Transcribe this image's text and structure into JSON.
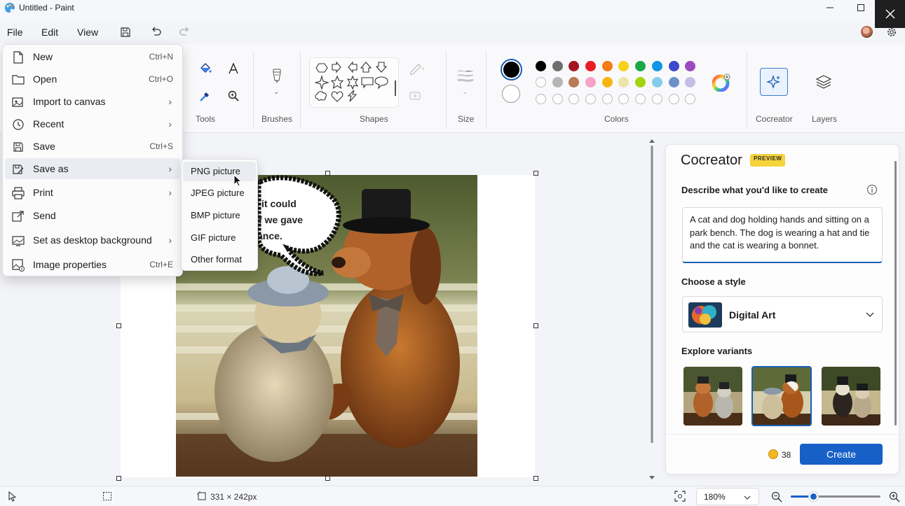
{
  "window": {
    "title": "Untitled - Paint"
  },
  "menubar": {
    "file": "File",
    "edit": "Edit",
    "view": "View"
  },
  "ribbon": {
    "tools_label": "Tools",
    "brushes_label": "Brushes",
    "shapes_label": "Shapes",
    "size_label": "Size",
    "colors_label": "Colors",
    "cocreator_label": "Cocreator",
    "layers_label": "Layers",
    "colors": {
      "active": "#000000",
      "row1": [
        "#000000",
        "#6e6e6e",
        "#a31621",
        "#ea1c24",
        "#f47b16",
        "#f7d11a",
        "#1ca84a",
        "#1296e6",
        "#3f47cc",
        "#9c4bbf"
      ],
      "row2": [
        "#ffffff",
        "#b5b5b5",
        "#b97a57",
        "#f5a3c7",
        "#f7b60f",
        "#eee3a8",
        "#a3d40e",
        "#84cde8",
        "#6f8fc9",
        "#c7bce4"
      ]
    }
  },
  "file_menu": {
    "items": [
      {
        "label": "New",
        "shortcut": "Ctrl+N",
        "icon": "new-file-icon"
      },
      {
        "label": "Open",
        "shortcut": "Ctrl+O",
        "icon": "open-folder-icon"
      },
      {
        "label": "Import to canvas",
        "icon": "import-icon",
        "submenu": true
      },
      {
        "label": "Recent",
        "icon": "clock-icon",
        "submenu": true
      },
      {
        "label": "Save",
        "shortcut": "Ctrl+S",
        "icon": "save-icon"
      },
      {
        "label": "Save as",
        "icon": "save-as-icon",
        "submenu": true
      },
      {
        "label": "Print",
        "icon": "printer-icon",
        "submenu": true
      },
      {
        "label": "Send",
        "icon": "send-icon"
      },
      {
        "label": "Set as desktop background",
        "icon": "desktop-icon",
        "submenu": true
      },
      {
        "label": "Image properties",
        "shortcut": "Ctrl+E",
        "icon": "image-properties-icon"
      }
    ]
  },
  "save_as_menu": {
    "items": [
      "PNG picture",
      "JPEG picture",
      "BMP picture",
      "GIF picture",
      "Other format"
    ]
  },
  "canvas": {
    "speech_text": [
      "it could",
      "f we gave",
      "ance."
    ]
  },
  "cocreator": {
    "title": "Cocreator",
    "badge": "PREVIEW",
    "describe_label": "Describe what you'd like to create",
    "prompt": "A cat and dog holding hands and sitting on a park bench. The dog is wearing a hat and tie and the cat is wearing a bonnet.",
    "style_label": "Choose a style",
    "style_value": "Digital Art",
    "variants_label": "Explore variants",
    "credits": "38",
    "create_button": "Create"
  },
  "status": {
    "dimensions": "331 × 242px",
    "zoom": "180%"
  }
}
